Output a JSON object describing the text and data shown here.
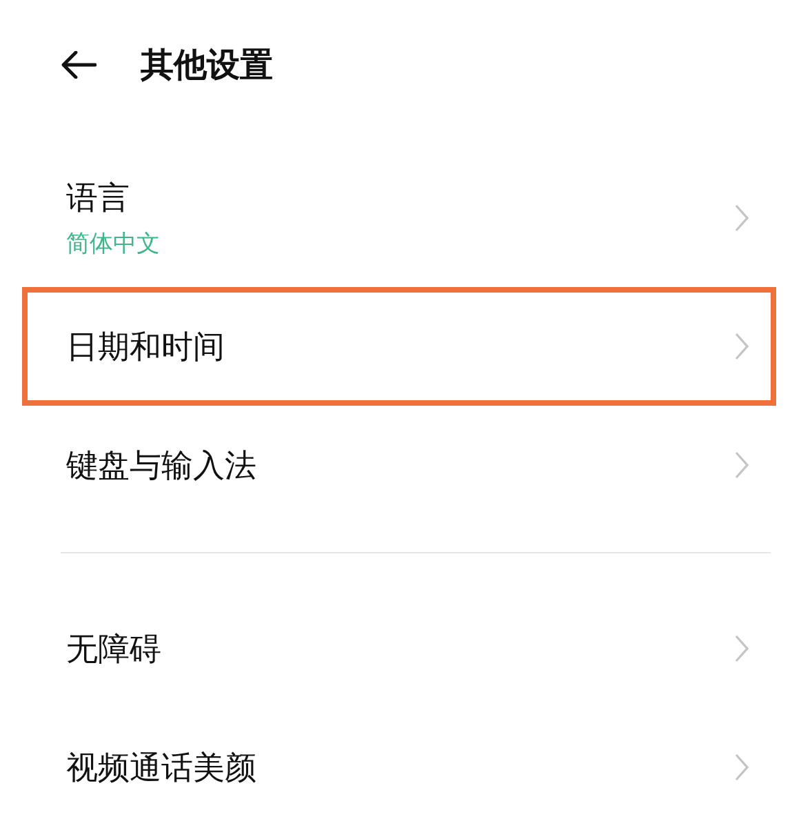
{
  "header": {
    "title": "其他设置"
  },
  "sections": [
    {
      "items": [
        {
          "label": "语言",
          "value": "简体中文",
          "highlighted": false
        },
        {
          "label": "日期和时间",
          "highlighted": true
        },
        {
          "label": "键盘与输入法",
          "highlighted": false
        }
      ]
    },
    {
      "items": [
        {
          "label": "无障碍",
          "highlighted": false
        },
        {
          "label": "视频通话美颜",
          "highlighted": false
        }
      ]
    }
  ]
}
